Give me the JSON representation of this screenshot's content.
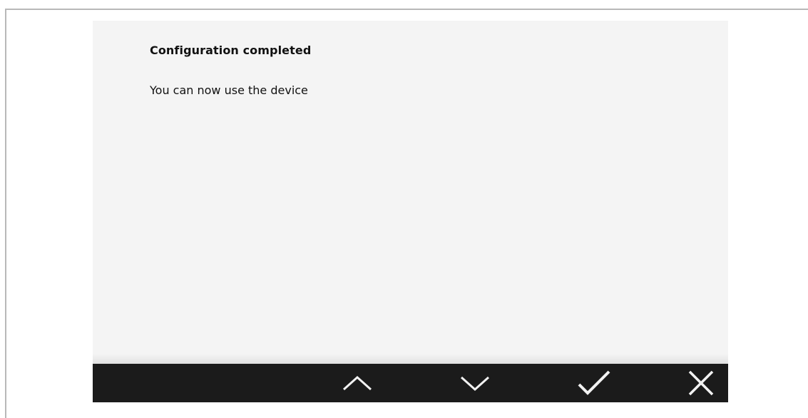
{
  "dialog": {
    "title": "Configuration completed",
    "message": "You can now use the device"
  },
  "toolbar": {
    "buttons": [
      {
        "name": "scroll-up-button",
        "icon": "chevron-up-icon"
      },
      {
        "name": "scroll-down-button",
        "icon": "chevron-down-icon"
      },
      {
        "name": "confirm-button",
        "icon": "checkmark-icon"
      },
      {
        "name": "close-button",
        "icon": "close-icon"
      }
    ]
  },
  "colors": {
    "screen_background": "#f4f4f4",
    "toolbar_background": "#1b1b1b",
    "toolbar_icon": "#f2f2f2",
    "text": "#111111",
    "frame_border": "#b8b8b8"
  }
}
